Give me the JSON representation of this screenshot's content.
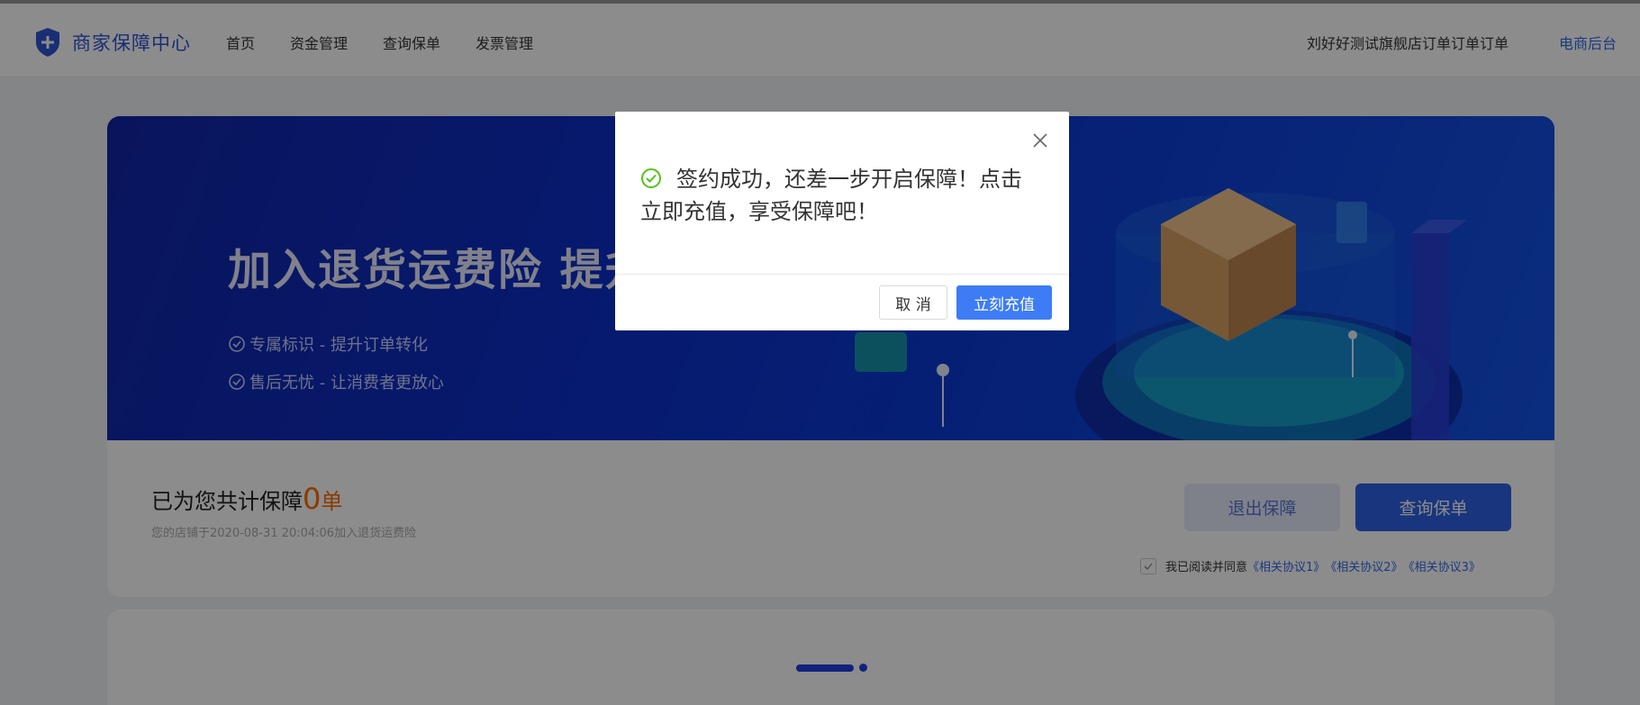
{
  "header": {
    "logo_text": "商家保障中心",
    "nav": [
      "首页",
      "资金管理",
      "查询保单",
      "发票管理"
    ],
    "store_name": "刘好好测试旗舰店订单订单订单",
    "backend_link": "电商后台"
  },
  "banner": {
    "title": "加入退货运费险 提升店",
    "features": [
      "专属标识 - 提升订单转化",
      "售后无忧 - 让消费者更放心"
    ]
  },
  "summary": {
    "prefix": "已为您共计保障",
    "count": "0",
    "unit": "单",
    "join_text": "您的店铺于2020-08-31 20:04:06加入退货运费险",
    "exit_button": "退出保障",
    "query_button": "查询保单",
    "agree_text": "我已阅读并同意",
    "agreements": [
      "《相关协议1》",
      "《相关协议2》",
      "《相关协议3》"
    ]
  },
  "modal": {
    "message": "签约成功，还差一步开启保障！点击立即充值，享受保障吧！",
    "cancel_label": "取 消",
    "confirm_label": "立刻充值"
  },
  "colors": {
    "brand": "#2e54d3",
    "primary": "#2f62e4",
    "accent_orange": "#ff6a00",
    "success_green": "#52c41a"
  },
  "icons": {
    "logo": "shield-plus-icon",
    "feature": "check-circle-icon",
    "modal_status": "success-check-circle-icon",
    "modal_close": "close-icon",
    "agree": "checkbox-check-icon"
  }
}
